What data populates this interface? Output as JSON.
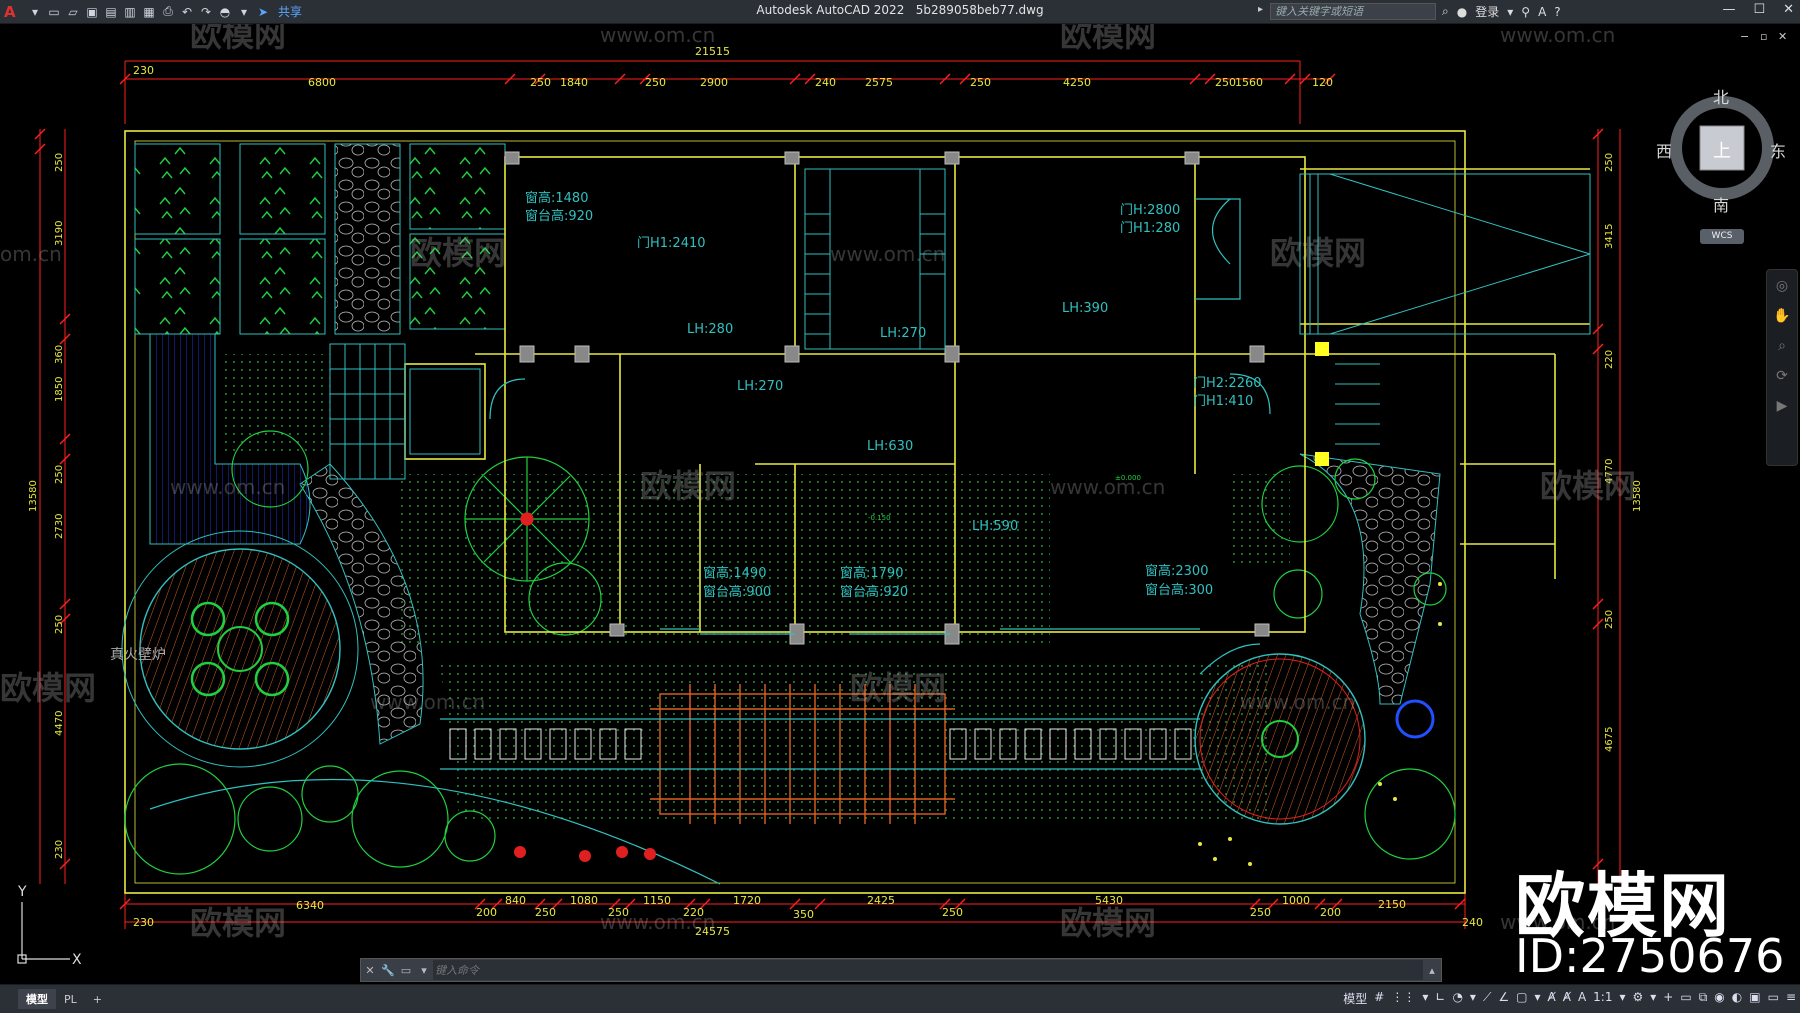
{
  "app": {
    "title": "Autodesk AutoCAD 2022",
    "filename": "5b289058beb77.dwg",
    "share_label": "共享",
    "search_placeholder": "键入关键字或短语",
    "login_label": "登录"
  },
  "colors": {
    "dim": "#ff2020",
    "wall": "#e8e840",
    "cyan": "#30c0c0",
    "green": "#20d040",
    "wood": "#e06020",
    "blue": "#2040e0",
    "white": "#ffffff"
  },
  "drawing": {
    "top_total": "21515",
    "top_dims": [
      "230",
      "6800",
      "250",
      "1840",
      "250",
      "2900",
      "240",
      "2575",
      "250",
      "4250",
      "250",
      "1560",
      "120"
    ],
    "bottom_total": "24575",
    "bottom_dims": [
      "230",
      "6340",
      "200",
      "840",
      "250",
      "1080",
      "250",
      "1150",
      "220",
      "1720",
      "350",
      "2425",
      "250",
      "5430",
      "250",
      "1000",
      "200",
      "2150",
      "240"
    ],
    "left_dims": [
      "250",
      "3190",
      "360",
      "1850",
      "250",
      "2730",
      "250",
      "4470",
      "230"
    ],
    "left_total": "13580",
    "right_dims": [
      "250",
      "3415",
      "220",
      "4770",
      "250",
      "4675"
    ],
    "right_total": "13580",
    "room_labels": [
      "窗高:1480",
      "窗台高:920",
      "门H1:2410",
      "门H:2800",
      "门H1:280",
      "LH:390",
      "LH:280",
      "LH:270",
      "LH:270",
      "门H2:2260",
      "门H1:410",
      "LH:630",
      "LH:590",
      "窗高:1490",
      "窗台高:900",
      "窗高:1790",
      "窗台高:920",
      "窗高:2300",
      "窗台高:300",
      "真火壁炉",
      "±0.000",
      "-0.150"
    ]
  },
  "watermark": {
    "brand": "欧模网",
    "url": "www.om.cn",
    "url_short": "om.cn",
    "id": "ID:2750676"
  },
  "viewcube": {
    "north": "北",
    "south": "南",
    "east": "东",
    "west": "西",
    "top": "上",
    "wcs": "WCS"
  },
  "ucs": {
    "x": "X",
    "y": "Y"
  },
  "command": {
    "placeholder": "键入命令"
  },
  "status": {
    "tab_model": "模型",
    "tab_layout": "PL",
    "add": "+",
    "model_label": "模型",
    "scale": "1:1"
  }
}
